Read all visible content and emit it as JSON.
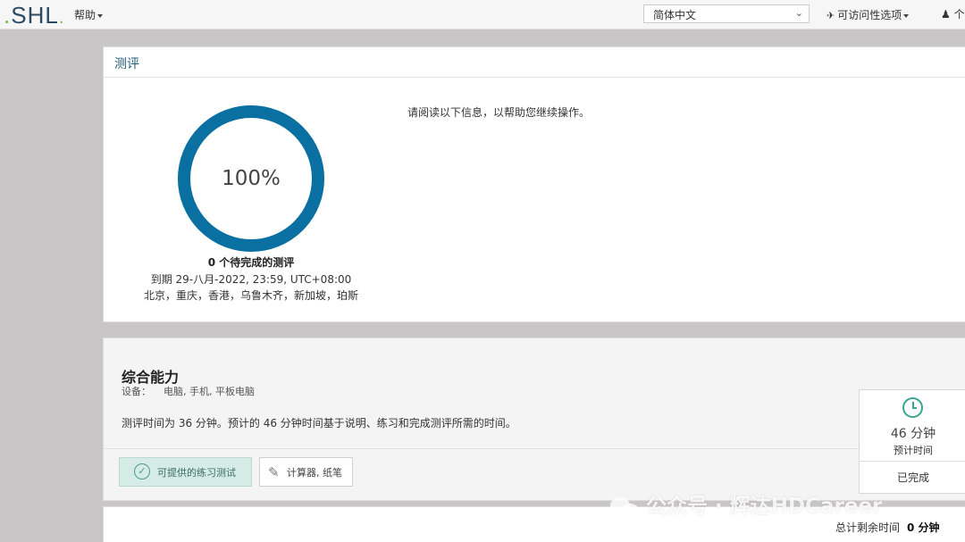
{
  "header": {
    "logo_text": ".SHL.",
    "help_label": "帮助",
    "language_selected": "简体中文",
    "accessibility_label": "可访问性选项",
    "user_label": "个"
  },
  "overview": {
    "panel_title": "测评",
    "progress_percent_text": "100%",
    "progress_fraction": 1.0,
    "pending_text": "0 个待完成的测评",
    "due_text": "到期 29-八月-2022, 23:59, UTC+08:00",
    "zones_text": "北京，重庆，香港，乌鲁木齐，新加坡，珀斯",
    "info_text": "请阅读以下信息，以帮助您继续操作。"
  },
  "assessment": {
    "title": "综合能力",
    "devices_label": "设备：",
    "devices_value": "电脑, 手机, 平板电脑",
    "duration_text": "测评时间为 36 分钟。预计的 46 分钟时间基于说明、练习和完成测评所需的时间。",
    "practice_button": "可提供的练习测试",
    "tools_button": "计算器, 纸笔",
    "estimate_value": "46 分钟",
    "estimate_label": "预计时间",
    "status": "已完成"
  },
  "footer": {
    "remaining_label": "总计剩余时间",
    "remaining_value": "0 分钟"
  },
  "watermark": "公众号 · 辉达HDCareer",
  "colors": {
    "ring": "#0a6fa1",
    "accent_green": "#3aa590",
    "title_blue": "#1f5a7a"
  }
}
